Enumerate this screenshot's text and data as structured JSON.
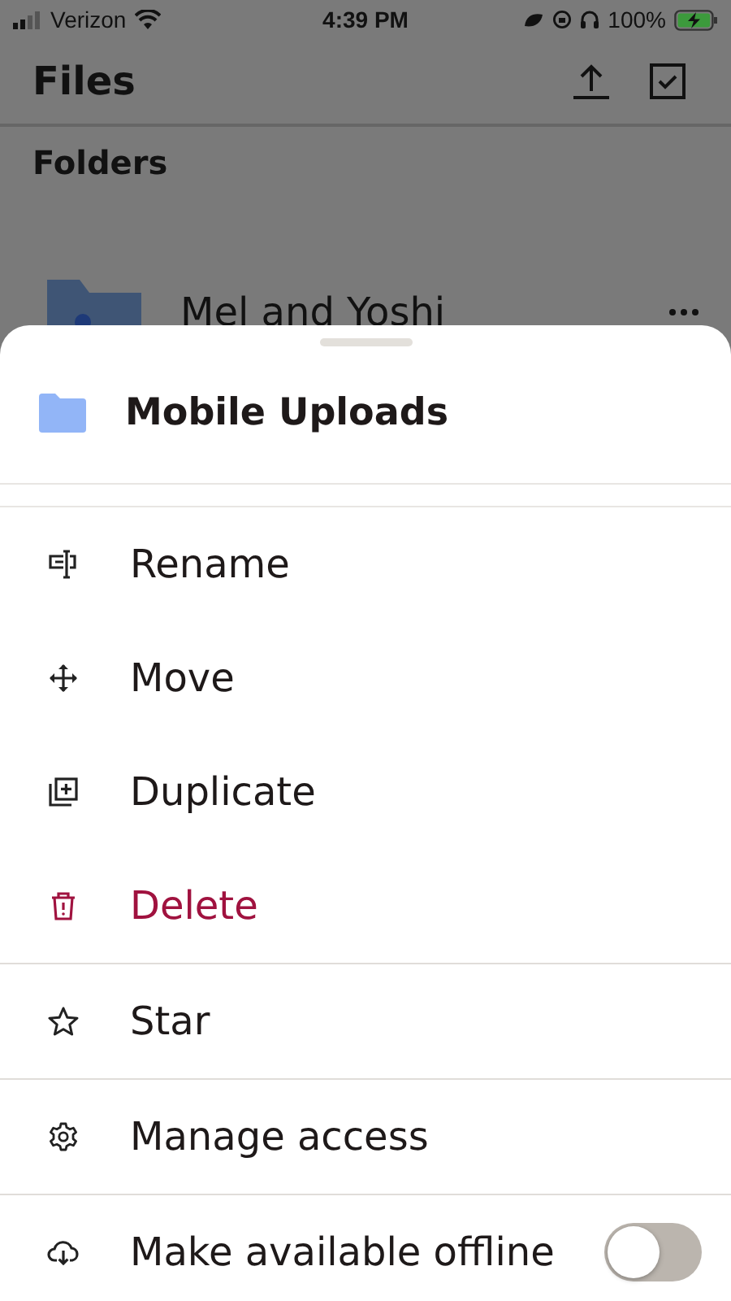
{
  "status_bar": {
    "carrier": "Verizon",
    "time": "4:39 PM",
    "battery": "100%"
  },
  "header": {
    "title": "Files"
  },
  "section_title": "Folders",
  "folder": {
    "name": "Mel and Yoshi"
  },
  "sheet": {
    "title": "Mobile Uploads",
    "sections": [
      [
        {
          "label": "Rename",
          "kind": "rename"
        },
        {
          "label": "Move",
          "kind": "move"
        },
        {
          "label": "Duplicate",
          "kind": "duplicate"
        },
        {
          "label": "Delete",
          "kind": "delete"
        }
      ],
      [
        {
          "label": "Star",
          "kind": "star"
        }
      ],
      [
        {
          "label": "Manage access",
          "kind": "access"
        }
      ],
      [
        {
          "label": "Make available offline",
          "kind": "offline",
          "on": false
        }
      ]
    ]
  }
}
